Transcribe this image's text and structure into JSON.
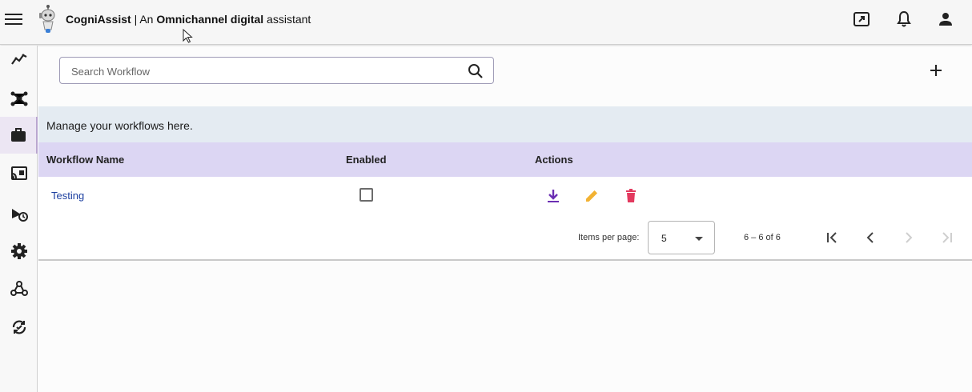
{
  "header": {
    "brand_name": "CogniAssist",
    "separator": " | An ",
    "tag_bold_1": "Omnichannel digital",
    "tag_tail": " assistant"
  },
  "search": {
    "placeholder": "Search Workflow"
  },
  "card": {
    "intro": "Manage your workflows here.",
    "columns": [
      "Workflow Name",
      "Enabled",
      "Actions"
    ],
    "rows": [
      {
        "name": "Testing",
        "enabled": false
      }
    ]
  },
  "pager": {
    "items_label": "Items per page:",
    "page_size": "5",
    "range": "6 – 6 of 6"
  },
  "colors": {
    "download": "#6b2fb3",
    "edit": "#f2b233",
    "delete": "#e33a5f",
    "header_bg": "#dcd6f3",
    "intro_bg": "#e4ebf2"
  }
}
